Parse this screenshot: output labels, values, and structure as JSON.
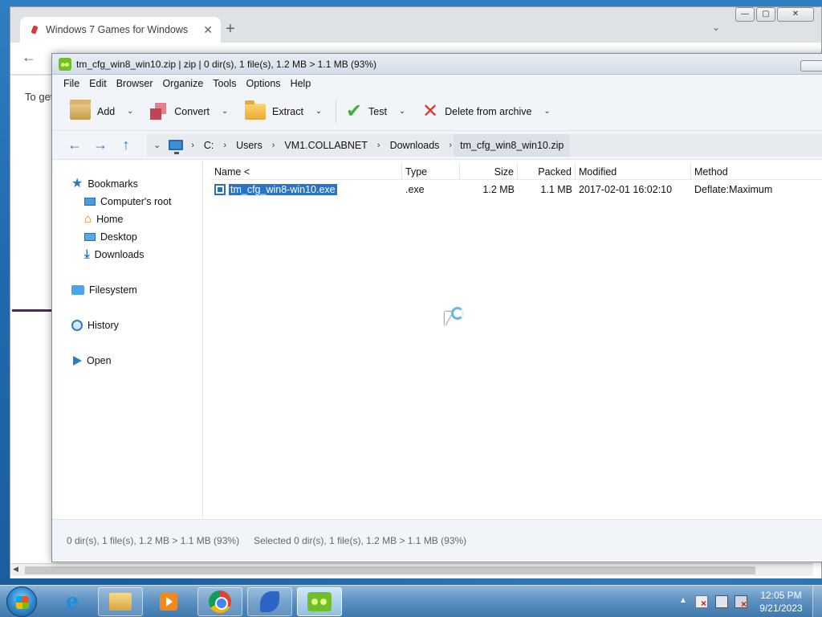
{
  "chrome": {
    "tab_title": "Windows 7 Games for Windows",
    "tab_close": "✕",
    "new_tab": "+",
    "tab_search": "⌄",
    "page_snippet": "To get",
    "win_min": "—",
    "win_max": "▢",
    "win_close": "✕",
    "back": "←"
  },
  "peazip": {
    "title": "tm_cfg_win8_win10.zip | zip | 0 dir(s), 1 file(s), 1.2 MB > 1.1 MB (93%)",
    "menu": [
      "File",
      "Edit",
      "Browser",
      "Organize",
      "Tools",
      "Options",
      "Help"
    ],
    "toolbar": {
      "add": "Add",
      "convert": "Convert",
      "extract": "Extract",
      "test": "Test",
      "delete": "Delete from archive",
      "dropdown": "⌄"
    },
    "nav": {
      "back": "←",
      "forward": "→",
      "up": "↑",
      "history_dd": "⌄"
    },
    "breadcrumb": [
      "C:",
      "Users",
      "VM1.COLLABNET",
      "Downloads",
      "tm_cfg_win8_win10.zip"
    ],
    "crumb_sep": "›",
    "sidebar": {
      "bookmarks": "Bookmarks",
      "computer_root": "Computer's root",
      "home": "Home",
      "desktop": "Desktop",
      "downloads": "Downloads",
      "filesystem": "Filesystem",
      "history": "History",
      "open": "Open"
    },
    "columns": {
      "name": "Name <",
      "type": "Type",
      "size": "Size",
      "packed": "Packed",
      "modified": "Modified",
      "method": "Method"
    },
    "files": [
      {
        "name": "tm_cfg_win8-win10.exe",
        "type": ".exe",
        "size": "1.2 MB",
        "packed": "1.1 MB",
        "modified": "2017-02-01 16:02:10",
        "method": "Deflate:Maximum"
      }
    ],
    "status_left": "0 dir(s), 1 file(s), 1.2 MB > 1.1 MB (93%)",
    "status_right": "Selected 0 dir(s), 1 file(s), 1.2 MB > 1.1 MB (93%)"
  },
  "taskbar": {
    "apps": [
      "internet-explorer",
      "windows-explorer",
      "media-player",
      "google-chrome",
      "wireshark",
      "peazip"
    ],
    "tray_arrow": "▲",
    "time": "12:05 PM",
    "date": "9/21/2023"
  }
}
